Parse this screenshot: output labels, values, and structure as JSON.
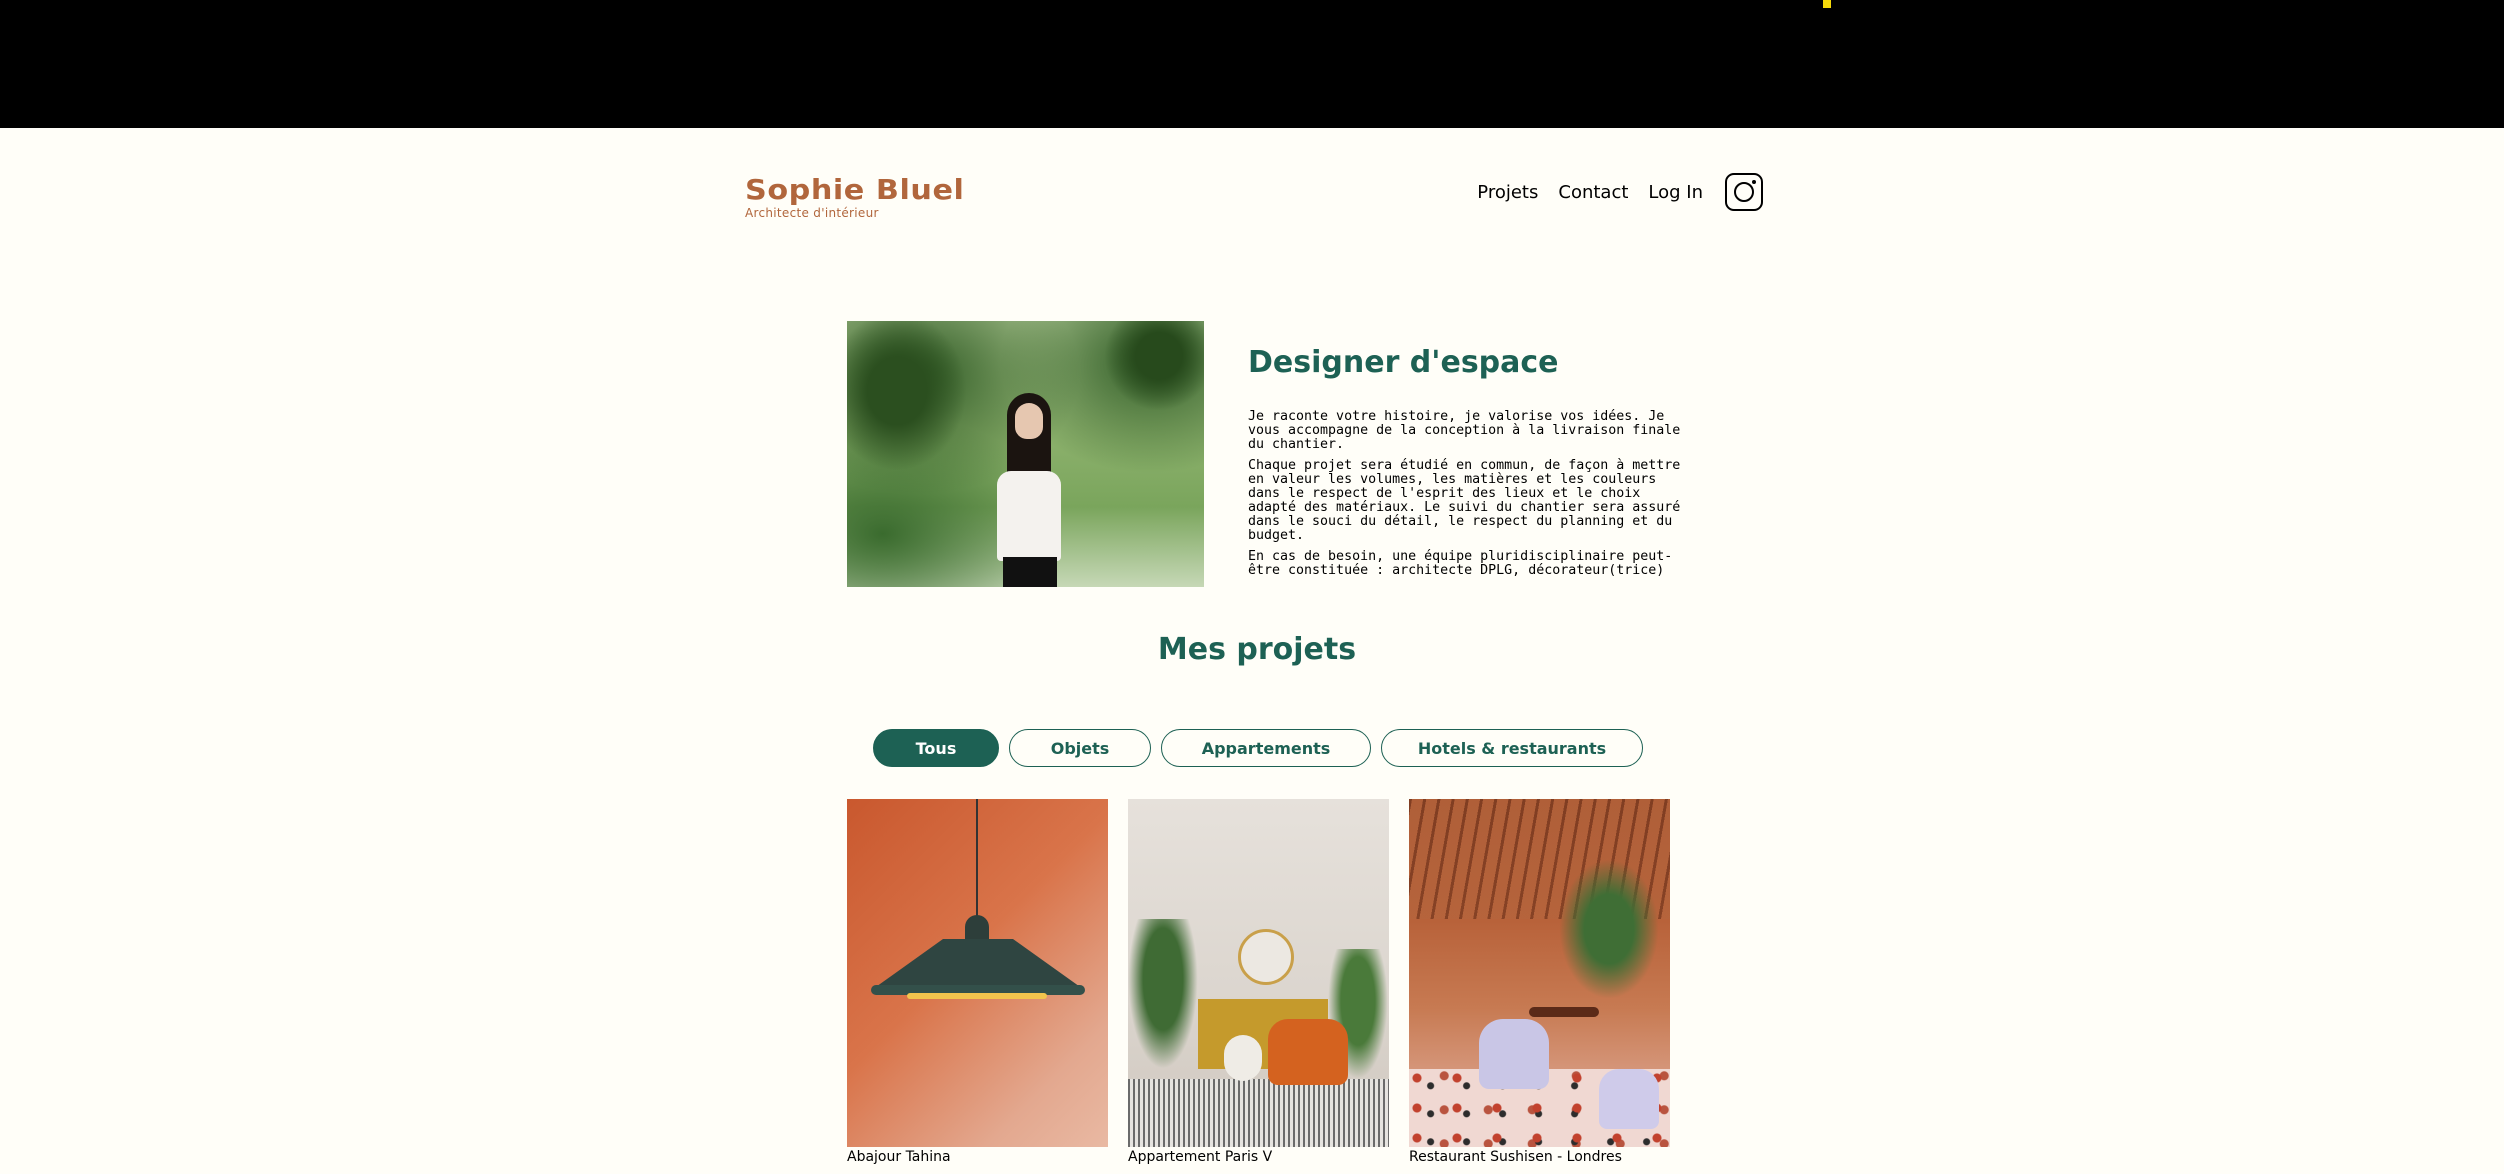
{
  "site": {
    "brand_name": "Sophie Bluel",
    "brand_subtitle": "Architecte d'intérieur"
  },
  "nav": {
    "items": [
      "Projets",
      "Contact",
      "Log In"
    ],
    "instagram_icon": "instagram-icon"
  },
  "intro": {
    "title": "Designer d'espace",
    "paragraphs": [
      "Je raconte votre histoire, je valorise vos idées. Je vous accompagne de la conception à la livraison finale du chantier.",
      "Chaque projet sera étudié en commun, de façon à mettre en valeur les volumes, les matières et les couleurs dans le respect de l'esprit des lieux et le choix adapté des matériaux. Le suivi du chantier sera assuré dans le souci du détail, le respect du planning et du budget.",
      "En cas de besoin, une équipe pluridisciplinaire peut-être constituée : architecte DPLG, décorateur(trice)"
    ]
  },
  "portfolio": {
    "title": "Mes projets",
    "filters": [
      "Tous",
      "Objets",
      "Appartements",
      "Hotels & restaurants"
    ],
    "active_filter": "Tous",
    "works": [
      {
        "caption": "Abajour Tahina"
      },
      {
        "caption": "Appartement Paris V"
      },
      {
        "caption": "Restaurant Sushisen - Londres"
      }
    ]
  },
  "colors": {
    "accent": "#1D6154",
    "brand": "#B1663C",
    "background": "#FFFEF8",
    "top_bar": "#000000"
  }
}
